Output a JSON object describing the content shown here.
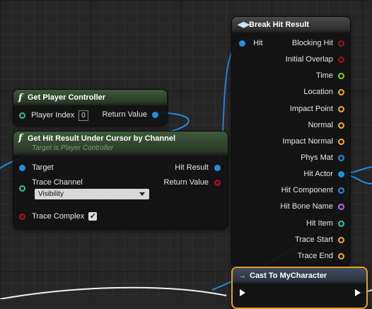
{
  "break_hit_result": {
    "title": "Break Hit Result",
    "input": "Hit",
    "outputs": [
      "Blocking Hit",
      "Initial Overlap",
      "Time",
      "Location",
      "Impact Point",
      "Normal",
      "Impact Normal",
      "Phys Mat",
      "Hit Actor",
      "Hit Component",
      "Hit Bone Name",
      "Hit Item",
      "Trace Start",
      "Trace End"
    ]
  },
  "get_player_controller": {
    "title": "Get Player Controller",
    "input_label": "Player Index",
    "input_value": "0",
    "output_label": "Return Value"
  },
  "get_hit_result": {
    "title": "Get Hit Result Under Cursor by Channel",
    "subtitle": "Target is Player Controller",
    "target_label": "Target",
    "hit_result_label": "Hit Result",
    "trace_channel_label": "Trace Channel",
    "trace_channel_value": "Visibility",
    "return_value_label": "Return Value",
    "trace_complex_label": "Trace Complex",
    "trace_complex_checked": "✓"
  },
  "cast": {
    "title": "Cast To MyCharacter"
  },
  "colors": {
    "background": "#262626",
    "exec_wire": "#ffffff",
    "object_wire": "#1f8fe0",
    "struct_wire": "#2a7fd4",
    "cast_border": "#e8a020"
  }
}
